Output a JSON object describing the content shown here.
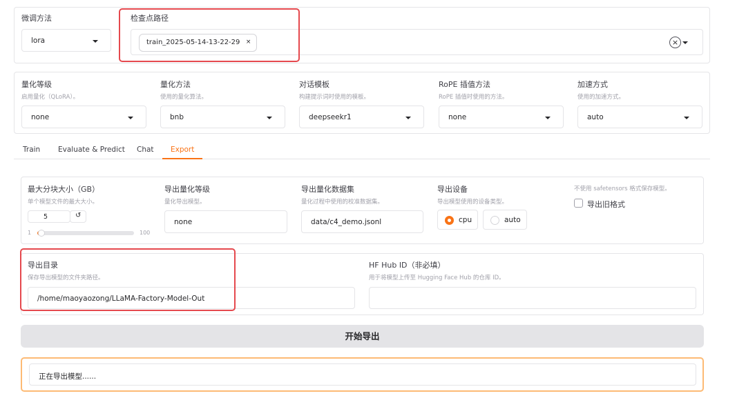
{
  "finetune": {
    "label": "微调方法",
    "value": "lora"
  },
  "checkpoint": {
    "label": "检查点路径",
    "tag": "train_2025-05-14-13-22-29",
    "tag_close": "×",
    "clear": "×"
  },
  "quant": [
    {
      "label": "量化等级",
      "info": "启用量化（QLoRA）。",
      "value": "none"
    },
    {
      "label": "量化方法",
      "info": "使用的量化算法。",
      "value": "bnb"
    },
    {
      "label": "对话模板",
      "info": "构建提示词时使用的模板。",
      "value": "deepseekr1"
    },
    {
      "label": "RoPE 插值方法",
      "info": "RoPE 插值时使用的方法。",
      "value": "none"
    },
    {
      "label": "加速方式",
      "info": "使用的加速方式。",
      "value": "auto"
    }
  ],
  "tabs": [
    "Train",
    "Evaluate & Predict",
    "Chat",
    "Export"
  ],
  "active_tab": "Export",
  "export": {
    "max_shard": {
      "label": "最大分块大小（GB）",
      "info": "单个模型文件的最大大小。",
      "value": "5",
      "reset": "↺",
      "min": "1",
      "max": "100",
      "fraction": 0.04
    },
    "quant_bit": {
      "label": "导出量化等级",
      "info": "量化导出模型。",
      "value": "none"
    },
    "quant_dataset": {
      "label": "导出量化数据集",
      "info": "量化过程中使用的校准数据集。",
      "value": "data/c4_demo.jsonl"
    },
    "device": {
      "label": "导出设备",
      "info": "导出模型使用的设备类型。",
      "options": [
        "cpu",
        "auto"
      ],
      "selected": "cpu"
    },
    "legacy": {
      "info": "不使用 safetensors 格式保存模型。",
      "label": "导出旧格式"
    },
    "dir": {
      "label": "导出目录",
      "info": "保存导出模型的文件夹路径。",
      "value": "/home/maoyaozong/LLaMA-Factory-Model-Out"
    },
    "hub": {
      "label": "HF Hub ID（非必填）",
      "info": "用于将模型上传至 Hugging Face Hub 的仓库 ID。",
      "value": ""
    }
  },
  "start_button": "开始导出",
  "output": "正在导出模型......",
  "colors": {
    "accent": "#f97316",
    "highlight": "#e5484d",
    "button_bg": "#e4e4e7"
  }
}
